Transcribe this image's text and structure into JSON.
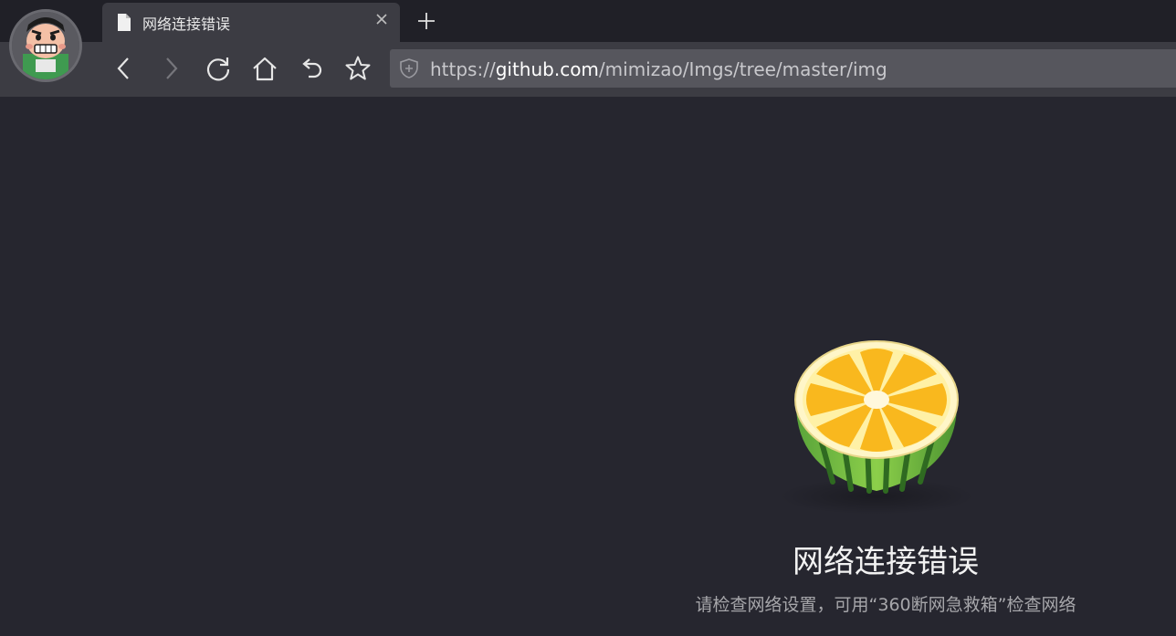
{
  "browser": {
    "tab": {
      "title": "网络连接错误",
      "icon": "document-icon"
    },
    "toolbar": {
      "buttons": [
        "back-icon",
        "forward-icon",
        "reload-icon",
        "home-icon",
        "undo-icon",
        "star-icon"
      ]
    },
    "address": {
      "scheme": "https://",
      "host": "github.com",
      "path": "/mimizao/Imgs/tree/master/img",
      "security_icon": "shield-icon"
    },
    "avatar": "cartoon-avatar"
  },
  "error": {
    "illustration": "watermelon-lemon-icon",
    "title": "网络连接错误",
    "subtitle": "请检查网络设置，可用“360断网急救箱”检查网络"
  },
  "colors": {
    "page_background": "#26262f",
    "toolbar": "#3c3c43",
    "tabstrip": "#202027",
    "address_bar": "#56565d"
  }
}
